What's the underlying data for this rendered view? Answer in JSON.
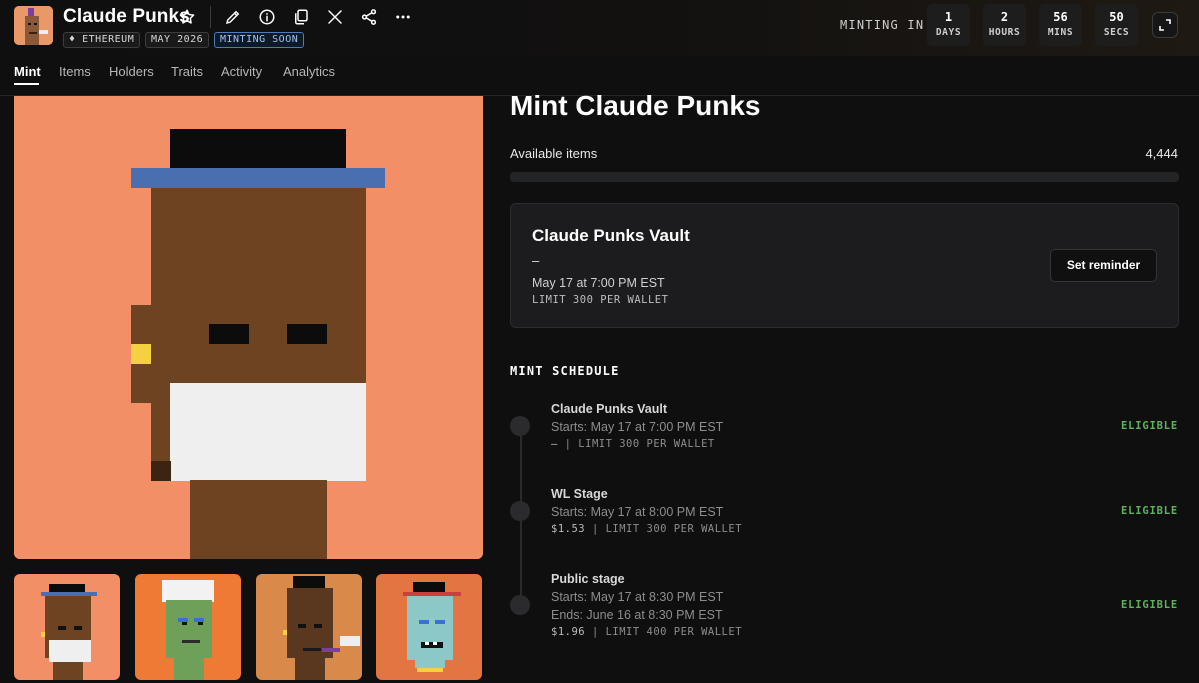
{
  "header": {
    "title": "Claude Punks",
    "badges": {
      "chain": "ETHEREUM",
      "date": "MAY 2026",
      "status": "MINTING SOON"
    },
    "countdown": {
      "label": "MINTING IN",
      "days": "1",
      "days_label": "DAYS",
      "hours": "2",
      "hours_label": "HOURS",
      "mins": "56",
      "mins_label": "MINS",
      "secs": "50",
      "secs_label": "SECS"
    },
    "icons": [
      "star-icon",
      "pencil-icon",
      "info-icon",
      "copy-icon",
      "x-logo-icon",
      "share-icon",
      "more-icon",
      "expand-icon"
    ]
  },
  "tabs": [
    "Mint",
    "Items",
    "Holders",
    "Traits",
    "Activity",
    "Analytics"
  ],
  "mint": {
    "title": "Mint Claude Punks",
    "available_label": "Available items",
    "available_value": "4,444",
    "progress": 0
  },
  "vault_card": {
    "name": "Claude Punks Vault",
    "price": "–",
    "date": "May 17 at 7:00 PM EST",
    "limit": "LIMIT 300 PER WALLET",
    "button": "Set reminder"
  },
  "schedule": {
    "heading": "MINT SCHEDULE",
    "stages": [
      {
        "name": "Claude Punks Vault",
        "starts": "Starts: May 17 at 7:00 PM EST",
        "ends": "",
        "price": "–",
        "limit": "| LIMIT 300 PER WALLET",
        "status": "ELIGIBLE"
      },
      {
        "name": "WL Stage",
        "starts": "Starts: May 17 at 8:00 PM EST",
        "ends": "",
        "price": "$1.53",
        "limit": "| LIMIT 300 PER WALLET",
        "status": "ELIGIBLE"
      },
      {
        "name": "Public stage",
        "starts": "Starts: May 17 at 8:30 PM EST",
        "ends": "Ends: June 16 at 8:30 PM EST",
        "price": "$1.96",
        "limit": "| LIMIT 400 PER WALLET",
        "status": "ELIGIBLE"
      }
    ]
  },
  "colors": {
    "background": "#0f0f10",
    "art_background": "#f28f66",
    "eligible": "#5fb05f",
    "soon_badge": "#4d7cb8"
  }
}
